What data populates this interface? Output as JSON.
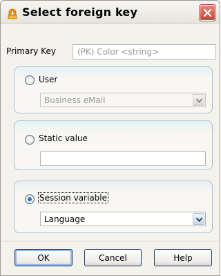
{
  "window": {
    "title": "Select foreign key",
    "title_icon": "key-lock-icon",
    "close_icon": "close-icon",
    "colors": {
      "title_icon": "#f39c12",
      "close_button": "#c5463a",
      "group_border": "#a6c7cf",
      "radio_dot": "#2a73c8"
    }
  },
  "primary_key": {
    "label": "Primary Key",
    "value": "(PK) Color <string>"
  },
  "user_group": {
    "radio_label": "User",
    "selected": false,
    "select_value": "Business eMail"
  },
  "static_group": {
    "radio_label": "Static value",
    "selected": false,
    "input_value": ""
  },
  "session_group": {
    "radio_label": "Session variable",
    "selected": true,
    "select_value": "Language"
  },
  "buttons": {
    "ok": "OK",
    "cancel": "Cancel",
    "help": "Help"
  }
}
